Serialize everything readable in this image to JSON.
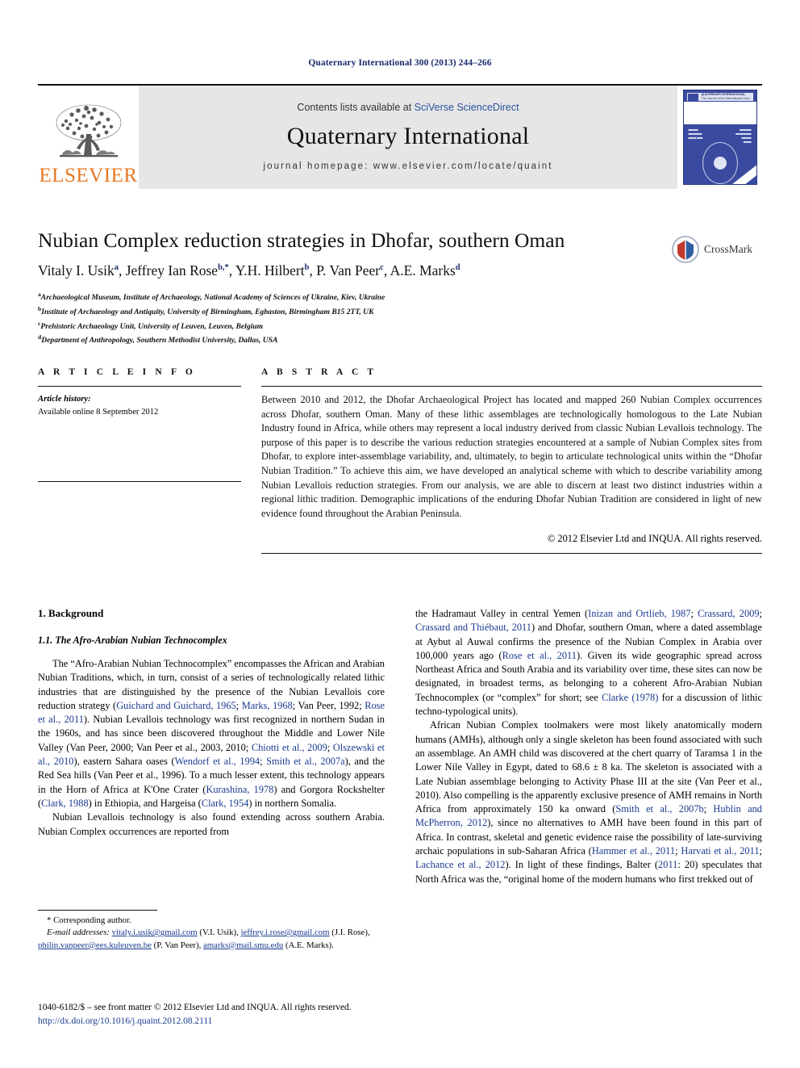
{
  "running_head": "Quaternary International 300 (2013) 244–266",
  "masthead": {
    "publisher_logo_text": "ELSEVIER",
    "contents_prefix": "Contents lists available at ",
    "contents_link": "SciVerse ScienceDirect",
    "journal_title": "Quaternary International",
    "homepage": "journal homepage: www.elsevier.com/locate/quaint",
    "cover_title": "QUATERNARY INTERNATIONAL",
    "cover_subtitle": "The Journal of the International Union for Quaternary Research"
  },
  "article": {
    "title": "Nubian Complex reduction strategies in Dhofar, southern Oman",
    "authors_html": "Vitaly I. Usik<sup>a</sup>, Jeffrey Ian Rose<sup>b,*</sup>, Y.H. Hilbert<sup>b</sup>, P. Van Peer<sup>c</sup>, A.E. Marks<sup>d</sup>",
    "affiliations": [
      {
        "mark": "a",
        "text": "Archaeological Museum, Institute of Archaeology, National Academy of Sciences of Ukraine, Kiev, Ukraine"
      },
      {
        "mark": "b",
        "text": "Institute of Archaeology and Antiquity, University of Birmingham, Egbaston, Birmingham B15 2TT, UK"
      },
      {
        "mark": "c",
        "text": "Prehistoric Archaeology Unit, University of Leuven, Leuven, Belgium"
      },
      {
        "mark": "d",
        "text": "Department of Anthropology, Southern Methodist University, Dallas, USA"
      }
    ],
    "crossmark_label": "CrossMark"
  },
  "article_info": {
    "heading": "A R T I C L E  I N F O",
    "history_label": "Article history:",
    "history_value": "Available online 8 September 2012"
  },
  "abstract": {
    "heading": "A B S T R A C T",
    "text": "Between 2010 and 2012, the Dhofar Archaeological Project has located and mapped 260 Nubian Complex occurrences across Dhofar, southern Oman. Many of these lithic assemblages are technologically homologous to the Late Nubian Industry found in Africa, while others may represent a local industry derived from classic Nubian Levallois technology. The purpose of this paper is to describe the various reduction strategies encountered at a sample of Nubian Complex sites from Dhofar, to explore inter-assemblage variability, and, ultimately, to begin to articulate technological units within the “Dhofar Nubian Tradition.” To achieve this aim, we have developed an analytical scheme with which to describe variability among Nubian Levallois reduction strategies. From our analysis, we are able to discern at least two distinct industries within a regional lithic tradition. Demographic implications of the enduring Dhofar Nubian Tradition are considered in light of new evidence found throughout the Arabian Peninsula.",
    "copyright": "© 2012 Elsevier Ltd and INQUA. All rights reserved."
  },
  "body": {
    "section_number_title": "1. Background",
    "subsection_number_title": "1.1. The Afro-Arabian Nubian Technocomplex",
    "left_paragraphs": [
      "The “Afro-Arabian Nubian Technocomplex” encompasses the African and Arabian Nubian Traditions, which, in turn, consist of a series of technologically related lithic industries that are distinguished by the presence of the Nubian Levallois core reduction strategy (Guichard and Guichard, 1965; Marks, 1968; Van Peer, 1992; Rose et al., 2011). Nubian Levallois technology was first recognized in northern Sudan in the 1960s, and has since been discovered throughout the Middle and Lower Nile Valley (Van Peer, 2000; Van Peer et al., 2003, 2010; Chiotti et al., 2009; Olszewski et al., 2010), eastern Sahara oases (Wendorf et al., 1994; Smith et al., 2007a), and the Red Sea hills (Van Peer et al., 1996). To a much lesser extent, this technology appears in the Horn of Africa at K'One Crater (Kurashina, 1978) and Gorgora Rockshelter (Clark, 1988) in Ethiopia, and Hargeisa (Clark, 1954) in northern Somalia.",
      "Nubian Levallois technology is also found extending across southern Arabia. Nubian Complex occurrences are reported from"
    ],
    "right_paragraphs": [
      "the Hadramaut Valley in central Yemen (Inizan and Ortlieb, 1987; Crassard, 2009; Crassard and Thiébaut, 2011) and Dhofar, southern Oman, where a dated assemblage at Aybut al Auwal confirms the presence of the Nubian Complex in Arabia over 100,000 years ago (Rose et al., 2011). Given its wide geographic spread across Northeast Africa and South Arabia and its variability over time, these sites can now be designated, in broadest terms, as belonging to a coherent Afro-Arabian Nubian Technocomplex (or “complex” for short; see Clarke (1978) for a discussion of lithic techno-typological units).",
      "African Nubian Complex toolmakers were most likely anatomically modern humans (AMHs), although only a single skeleton has been found associated with such an assemblage. An AMH child was discovered at the chert quarry of Taramsa 1 in the Lower Nile Valley in Egypt, dated to 68.6 ± 8 ka. The skeleton is associated with a Late Nubian assemblage belonging to Activity Phase III at the site (Van Peer et al., 2010). Also compelling is the apparently exclusive presence of AMH remains in North Africa from approximately 150 ka onward (Smith et al., 2007b; Hublin and McPherron, 2012), since no alternatives to AMH have been found in this part of Africa. In contrast, skeletal and genetic evidence raise the possibility of late-surviving archaic populations in sub-Saharan Africa (Hammer et al., 2011; Harvati et al., 2011; Lachance et al., 2012). In light of these findings, Balter (2011: 20) speculates that North Africa was the, “original home of the modern humans who first trekked out of"
    ]
  },
  "footnotes": {
    "corresponding": "* Corresponding author.",
    "email_label": "E-mail addresses:",
    "emails": [
      {
        "address": "vitaly.i.usik@gmail.com",
        "owner": "(V.I. Usik)"
      },
      {
        "address": "jeffrey.i.rose@gmail.com",
        "owner": "(J.I. Rose)"
      },
      {
        "address": "philip.vanpeer@ees.kuleuven.be",
        "owner": "(P. Van Peer)"
      },
      {
        "address": "amarks@mail.smu.edu",
        "owner": "(A.E. Marks)"
      }
    ]
  },
  "imprint": {
    "line1": "1040-6182/$ – see front matter © 2012 Elsevier Ltd and INQUA. All rights reserved.",
    "doi": "http://dx.doi.org/10.1016/j.quaint.2012.08.2111"
  },
  "colors": {
    "running_head": "#1a2a6c",
    "citation_link": "#1a3a8f",
    "elsevier_orange": "#E87722",
    "masthead_grey": "#e6e6e6",
    "cover_blue": "#3a4a9f"
  }
}
